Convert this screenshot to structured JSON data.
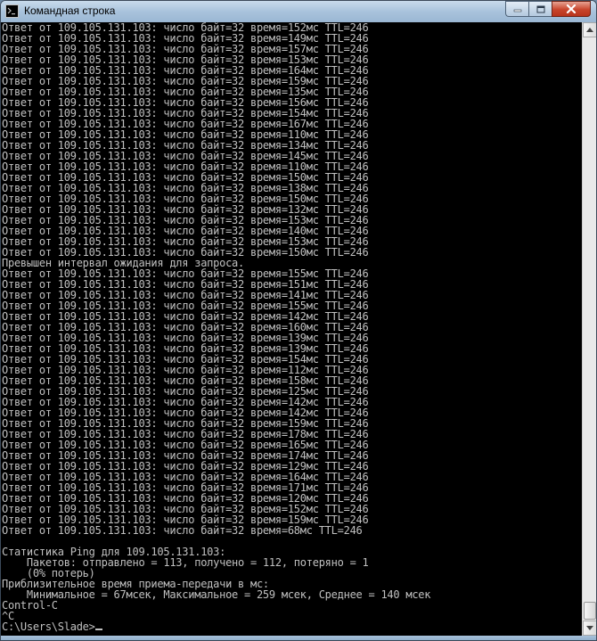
{
  "window": {
    "title": "Командная строка"
  },
  "console": {
    "lines": [
      "Ответ от 109.105.131.103: число байт=32 время=152мс TTL=246",
      "Ответ от 109.105.131.103: число байт=32 время=149мс TTL=246",
      "Ответ от 109.105.131.103: число байт=32 время=157мс TTL=246",
      "Ответ от 109.105.131.103: число байт=32 время=153мс TTL=246",
      "Ответ от 109.105.131.103: число байт=32 время=164мс TTL=246",
      "Ответ от 109.105.131.103: число байт=32 время=159мс TTL=246",
      "Ответ от 109.105.131.103: число байт=32 время=135мс TTL=246",
      "Ответ от 109.105.131.103: число байт=32 время=156мс TTL=246",
      "Ответ от 109.105.131.103: число байт=32 время=154мс TTL=246",
      "Ответ от 109.105.131.103: число байт=32 время=167мс TTL=246",
      "Ответ от 109.105.131.103: число байт=32 время=110мс TTL=246",
      "Ответ от 109.105.131.103: число байт=32 время=134мс TTL=246",
      "Ответ от 109.105.131.103: число байт=32 время=145мс TTL=246",
      "Ответ от 109.105.131.103: число байт=32 время=110мс TTL=246",
      "Ответ от 109.105.131.103: число байт=32 время=150мс TTL=246",
      "Ответ от 109.105.131.103: число байт=32 время=138мс TTL=246",
      "Ответ от 109.105.131.103: число байт=32 время=150мс TTL=246",
      "Ответ от 109.105.131.103: число байт=32 время=132мс TTL=246",
      "Ответ от 109.105.131.103: число байт=32 время=153мс TTL=246",
      "Ответ от 109.105.131.103: число байт=32 время=140мс TTL=246",
      "Ответ от 109.105.131.103: число байт=32 время=153мс TTL=246",
      "Ответ от 109.105.131.103: число байт=32 время=150мс TTL=246",
      "Превышен интервал ожидания для запроса.",
      "Ответ от 109.105.131.103: число байт=32 время=155мс TTL=246",
      "Ответ от 109.105.131.103: число байт=32 время=151мс TTL=246",
      "Ответ от 109.105.131.103: число байт=32 время=141мс TTL=246",
      "Ответ от 109.105.131.103: число байт=32 время=155мс TTL=246",
      "Ответ от 109.105.131.103: число байт=32 время=142мс TTL=246",
      "Ответ от 109.105.131.103: число байт=32 время=160мс TTL=246",
      "Ответ от 109.105.131.103: число байт=32 время=139мс TTL=246",
      "Ответ от 109.105.131.103: число байт=32 время=139мс TTL=246",
      "Ответ от 109.105.131.103: число байт=32 время=154мс TTL=246",
      "Ответ от 109.105.131.103: число байт=32 время=112мс TTL=246",
      "Ответ от 109.105.131.103: число байт=32 время=158мс TTL=246",
      "Ответ от 109.105.131.103: число байт=32 время=125мс TTL=246",
      "Ответ от 109.105.131.103: число байт=32 время=142мс TTL=246",
      "Ответ от 109.105.131.103: число байт=32 время=142мс TTL=246",
      "Ответ от 109.105.131.103: число байт=32 время=159мс TTL=246",
      "Ответ от 109.105.131.103: число байт=32 время=178мс TTL=246",
      "Ответ от 109.105.131.103: число байт=32 время=165мс TTL=246",
      "Ответ от 109.105.131.103: число байт=32 время=174мс TTL=246",
      "Ответ от 109.105.131.103: число байт=32 время=129мс TTL=246",
      "Ответ от 109.105.131.103: число байт=32 время=164мс TTL=246",
      "Ответ от 109.105.131.103: число байт=32 время=171мс TTL=246",
      "Ответ от 109.105.131.103: число байт=32 время=120мс TTL=246",
      "Ответ от 109.105.131.103: число байт=32 время=152мс TTL=246",
      "Ответ от 109.105.131.103: число байт=32 время=159мс TTL=246",
      "Ответ от 109.105.131.103: число байт=32 время=68мс TTL=246",
      "",
      "Статистика Ping для 109.105.131.103:",
      "    Пакетов: отправлено = 113, получено = 112, потеряно = 1",
      "    (0% потерь)",
      "Приблизительное время приема-передачи в мс:",
      "    Минимальное = 67мсек, Максимальное = 259 мсек, Среднее = 140 мсек",
      "Control-C",
      "^C"
    ],
    "prompt": "C:\\Users\\Slade>"
  },
  "colors": {
    "console_bg": "#000000",
    "console_fg": "#c0c0c0"
  },
  "icons": {
    "app": "cmd-icon",
    "minimize": "minimize-icon",
    "maximize": "maximize-icon",
    "close": "close-icon"
  }
}
